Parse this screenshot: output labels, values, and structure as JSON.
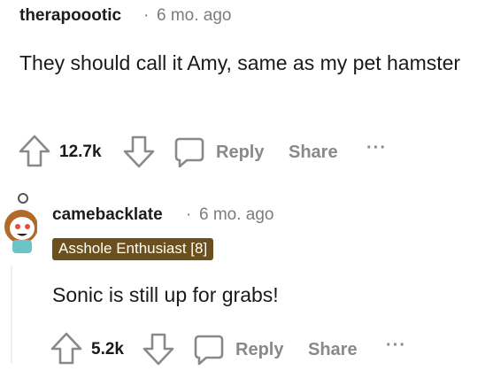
{
  "comments": [
    {
      "username": "therapoootic",
      "separator": "·",
      "time": "6 mo. ago",
      "text": "They should call it Amy, same as my pet hamster",
      "votes": "12.7k",
      "reply_label": "Reply",
      "share_label": "Share",
      "more_label": "···"
    },
    {
      "username": "camebacklate",
      "separator": "·",
      "time": "6 mo. ago",
      "flair": "Asshole Enthusiast [8]",
      "text": "Sonic is still up for grabs!",
      "votes": "5.2k",
      "reply_label": "Reply",
      "share_label": "Share",
      "more_label": "···"
    }
  ],
  "colors": {
    "flair_bg": "#6b4f1d",
    "muted": "#878a8c",
    "thread_line": "#edeff1"
  }
}
